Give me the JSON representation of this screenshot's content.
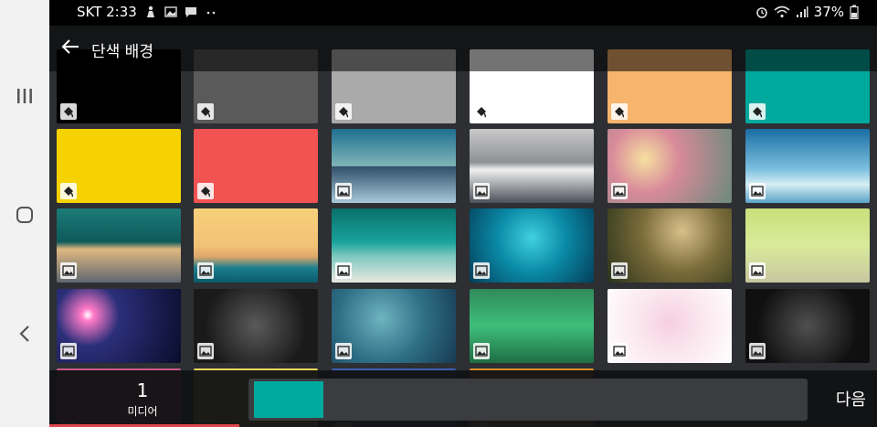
{
  "status_bar": {
    "carrier_time": "SKT 2:33",
    "battery": "37%"
  },
  "header": {
    "title": "단색 배경"
  },
  "grid": {
    "rows": [
      [
        {
          "kind": "solid",
          "color": "#000000"
        },
        {
          "kind": "solid",
          "color": "#5a5a5a"
        },
        {
          "kind": "solid",
          "color": "#aaaaaa"
        },
        {
          "kind": "solid",
          "color": "#ffffff"
        },
        {
          "kind": "solid",
          "color": "#f6b46d"
        },
        {
          "kind": "solid",
          "color": "#00a99d"
        }
      ],
      [
        {
          "kind": "solid",
          "color": "#f6d300"
        },
        {
          "kind": "solid",
          "color": "#f15252"
        },
        {
          "kind": "image",
          "theme": "blue mountains"
        },
        {
          "kind": "image",
          "theme": "snowy peaks"
        },
        {
          "kind": "image",
          "theme": "pink bokeh"
        },
        {
          "kind": "image",
          "theme": "sky clouds"
        }
      ],
      [
        {
          "kind": "image",
          "theme": "zigzag"
        },
        {
          "kind": "image",
          "theme": "sunset sea"
        },
        {
          "kind": "image",
          "theme": "teal beach"
        },
        {
          "kind": "image",
          "theme": "water bubbles"
        },
        {
          "kind": "image",
          "theme": "grass bokeh"
        },
        {
          "kind": "image",
          "theme": "lime blur"
        }
      ],
      [
        {
          "kind": "image",
          "theme": "lens flare"
        },
        {
          "kind": "image",
          "theme": "ornamental black"
        },
        {
          "kind": "image",
          "theme": "globe teal"
        },
        {
          "kind": "image",
          "theme": "green forest"
        },
        {
          "kind": "image",
          "theme": "pink hearts"
        },
        {
          "kind": "image",
          "theme": "black frame"
        }
      ],
      [
        {
          "kind": "solid",
          "color": "#c85a8a"
        },
        {
          "kind": "solid",
          "color": "#e8d45a"
        },
        {
          "kind": "solid",
          "color": "#3a5fb0"
        },
        {
          "kind": "solid",
          "color": "#e0902a"
        }
      ]
    ]
  },
  "bottom_bar": {
    "media_count": "1",
    "media_label": "미디어",
    "next_label": "다음",
    "selected_color": "#00a99d",
    "progress_fraction": 0.23
  }
}
